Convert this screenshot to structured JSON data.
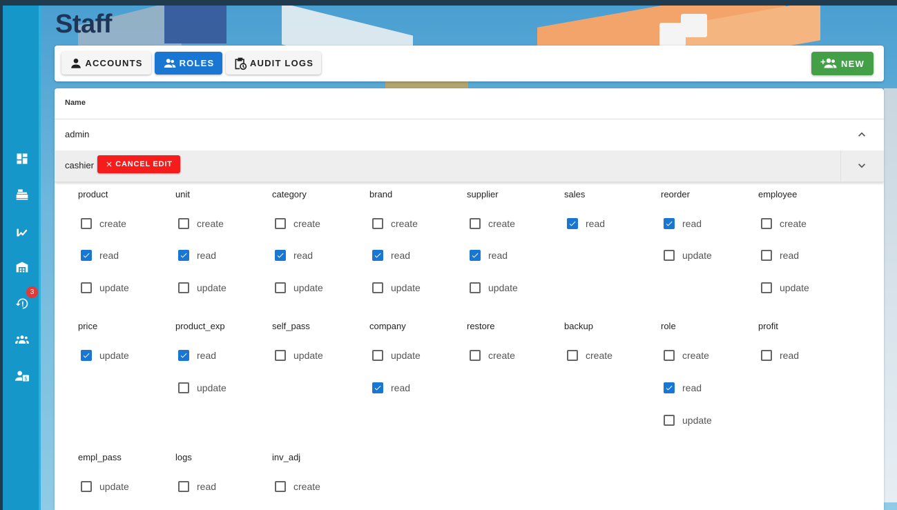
{
  "page": {
    "title": "Staff"
  },
  "sidebar": {
    "items": [
      {
        "icon": "dashboard-icon"
      },
      {
        "icon": "pos-register-icon"
      },
      {
        "icon": "sales-chart-icon"
      },
      {
        "icon": "warehouse-icon"
      },
      {
        "icon": "alert-restore-icon",
        "badge": "3"
      },
      {
        "icon": "staff-group-icon"
      },
      {
        "icon": "user-money-icon"
      }
    ]
  },
  "toolbar": {
    "tabs": [
      {
        "label": "ACCOUNTS",
        "icon": "person-icon",
        "active": false
      },
      {
        "label": "ROLES",
        "icon": "group-icon",
        "active": true
      },
      {
        "label": "AUDIT LOGS",
        "icon": "clipboard-clock-icon",
        "active": false
      }
    ],
    "new_label": "NEW"
  },
  "table": {
    "header": {
      "name": "Name"
    },
    "rows": [
      {
        "name": "admin",
        "expanded": false
      },
      {
        "name": "cashier",
        "editing": true,
        "cancel_label": "CANCEL EDIT"
      }
    ]
  },
  "permissions": [
    {
      "title": "product",
      "items": [
        {
          "label": "create",
          "checked": false
        },
        {
          "label": "read",
          "checked": true
        },
        {
          "label": "update",
          "checked": false
        }
      ]
    },
    {
      "title": "unit",
      "items": [
        {
          "label": "create",
          "checked": false
        },
        {
          "label": "read",
          "checked": true
        },
        {
          "label": "update",
          "checked": false
        }
      ]
    },
    {
      "title": "category",
      "items": [
        {
          "label": "create",
          "checked": false
        },
        {
          "label": "read",
          "checked": true
        },
        {
          "label": "update",
          "checked": false
        }
      ]
    },
    {
      "title": "brand",
      "items": [
        {
          "label": "create",
          "checked": false
        },
        {
          "label": "read",
          "checked": true
        },
        {
          "label": "update",
          "checked": false
        }
      ]
    },
    {
      "title": "supplier",
      "items": [
        {
          "label": "create",
          "checked": false
        },
        {
          "label": "read",
          "checked": true
        },
        {
          "label": "update",
          "checked": false
        }
      ]
    },
    {
      "title": "sales",
      "items": [
        {
          "label": "read",
          "checked": true
        }
      ]
    },
    {
      "title": "reorder",
      "items": [
        {
          "label": "read",
          "checked": true
        },
        {
          "label": "update",
          "checked": false
        }
      ]
    },
    {
      "title": "employee",
      "items": [
        {
          "label": "create",
          "checked": false
        },
        {
          "label": "read",
          "checked": false
        },
        {
          "label": "update",
          "checked": false
        }
      ]
    },
    {
      "title": "price",
      "items": [
        {
          "label": "update",
          "checked": true
        }
      ]
    },
    {
      "title": "product_exp",
      "items": [
        {
          "label": "read",
          "checked": true
        },
        {
          "label": "update",
          "checked": false
        }
      ]
    },
    {
      "title": "self_pass",
      "items": [
        {
          "label": "update",
          "checked": false
        }
      ]
    },
    {
      "title": "company",
      "items": [
        {
          "label": "update",
          "checked": false
        },
        {
          "label": "read",
          "checked": true
        }
      ]
    },
    {
      "title": "restore",
      "items": [
        {
          "label": "create",
          "checked": false
        }
      ]
    },
    {
      "title": "backup",
      "items": [
        {
          "label": "create",
          "checked": false
        }
      ]
    },
    {
      "title": "role",
      "items": [
        {
          "label": "create",
          "checked": false
        },
        {
          "label": "read",
          "checked": true
        },
        {
          "label": "update",
          "checked": false
        }
      ]
    },
    {
      "title": "profit",
      "items": [
        {
          "label": "read",
          "checked": false
        }
      ]
    },
    {
      "title": "empl_pass",
      "items": [
        {
          "label": "update",
          "checked": false
        }
      ]
    },
    {
      "title": "logs",
      "items": [
        {
          "label": "read",
          "checked": false
        }
      ]
    },
    {
      "title": "inv_adj",
      "items": [
        {
          "label": "create",
          "checked": false
        }
      ]
    }
  ],
  "colors": {
    "accent": "#1976d2",
    "sidebar": "#1597c9",
    "new_button": "#43a047",
    "cancel_button": "#f71c1c",
    "title": "#1d3557"
  }
}
